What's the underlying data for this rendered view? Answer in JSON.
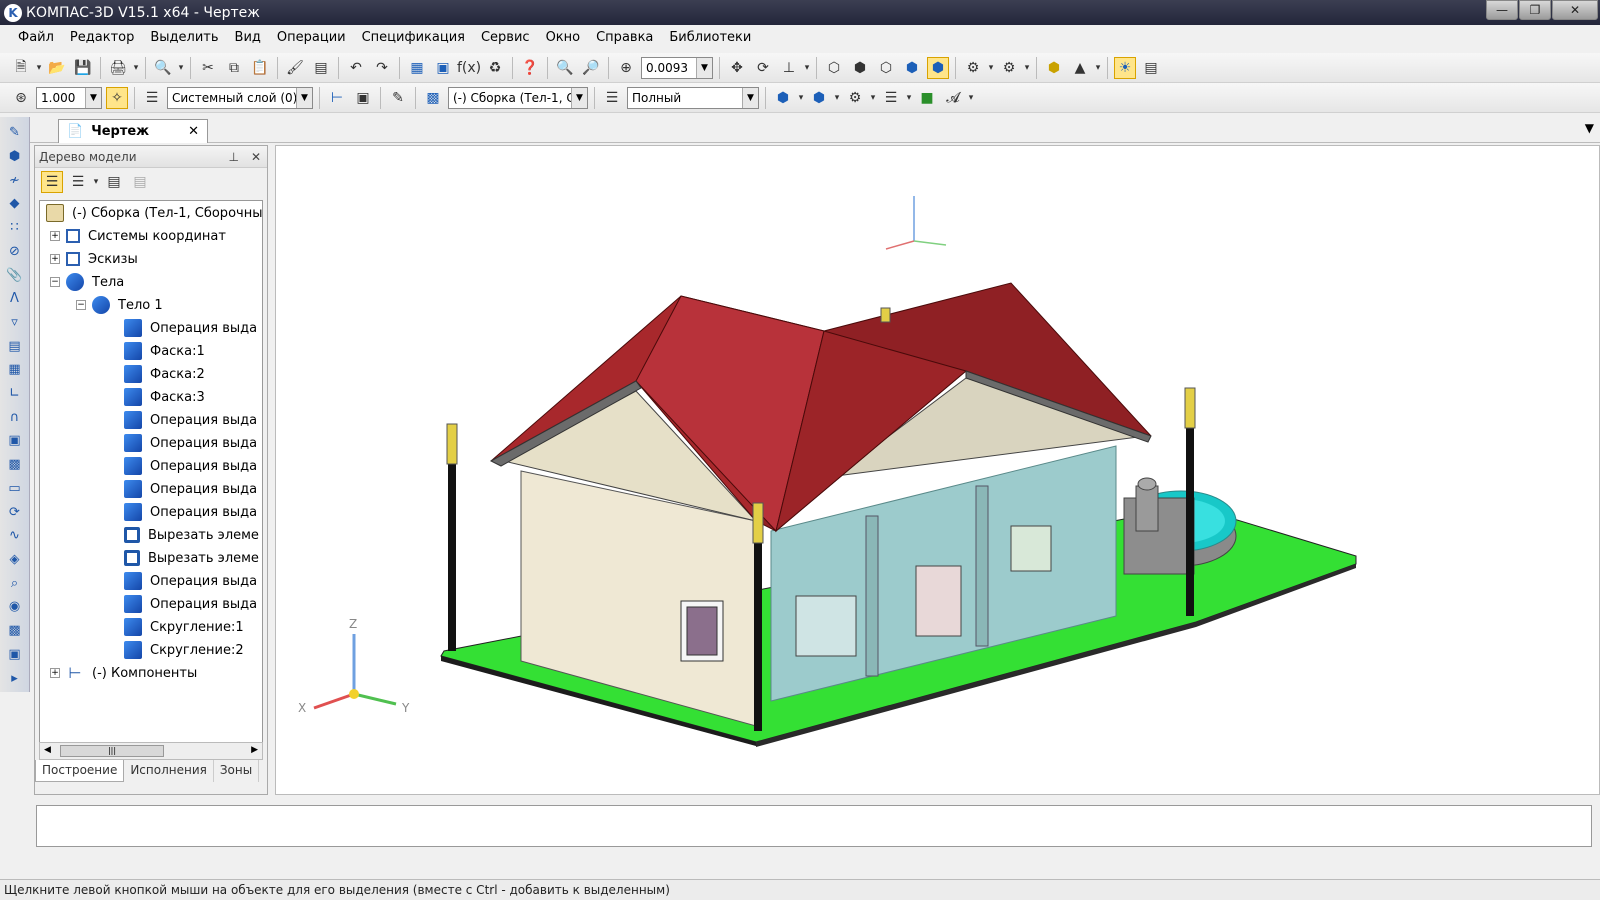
{
  "window": {
    "title": "КОМПАС-3D V15.1 x64 - Чертеж",
    "app_icon_letter": "K"
  },
  "menu": [
    "Файл",
    "Редактор",
    "Выделить",
    "Вид",
    "Операции",
    "Спецификация",
    "Сервис",
    "Окно",
    "Справка",
    "Библиотеки"
  ],
  "toolbar1": {
    "zoom_value": "0.0093"
  },
  "toolbar2": {
    "scale_value": "1.000",
    "layer_value": "Системный слой (0)",
    "assembly_value": "(-) Сборка (Тел-1, С",
    "display_mode": "Полный"
  },
  "doc_tab": {
    "label": "Чертеж",
    "close": "✕"
  },
  "tree_panel": {
    "title": "Дерево модели",
    "nodes": [
      {
        "label": "(-) Сборка (Тел-1, Сборочны"
      },
      {
        "label": "Системы координат"
      },
      {
        "label": "Эскизы"
      },
      {
        "label": "Тела"
      },
      {
        "label": "Тело 1"
      },
      {
        "label": "Операция выда"
      },
      {
        "label": "Фаска:1"
      },
      {
        "label": "Фаска:2"
      },
      {
        "label": "Фаска:3"
      },
      {
        "label": "Операция выда"
      },
      {
        "label": "Операция выда"
      },
      {
        "label": "Операция выда"
      },
      {
        "label": "Операция выда"
      },
      {
        "label": "Операция выда"
      },
      {
        "label": "Вырезать элеме"
      },
      {
        "label": "Вырезать элеме"
      },
      {
        "label": "Операция выда"
      },
      {
        "label": "Операция выда"
      },
      {
        "label": "Скругление:1"
      },
      {
        "label": "Скругление:2"
      },
      {
        "label": "(-) Компоненты"
      }
    ],
    "tabs": [
      "Построение",
      "Исполнения",
      "Зоны"
    ]
  },
  "axes": {
    "x": "X",
    "y": "Y",
    "z": "Z"
  },
  "status_text": "Щелкните левой кнопкой мыши на объекте для его выделения (вместе с Ctrl - добавить к выделенным)",
  "colors": {
    "roof": "#a8282c",
    "wall": "#f0ead8",
    "floor": "#33dd33",
    "glass": "#9cc9cc",
    "title_bar": "#2e3146"
  }
}
